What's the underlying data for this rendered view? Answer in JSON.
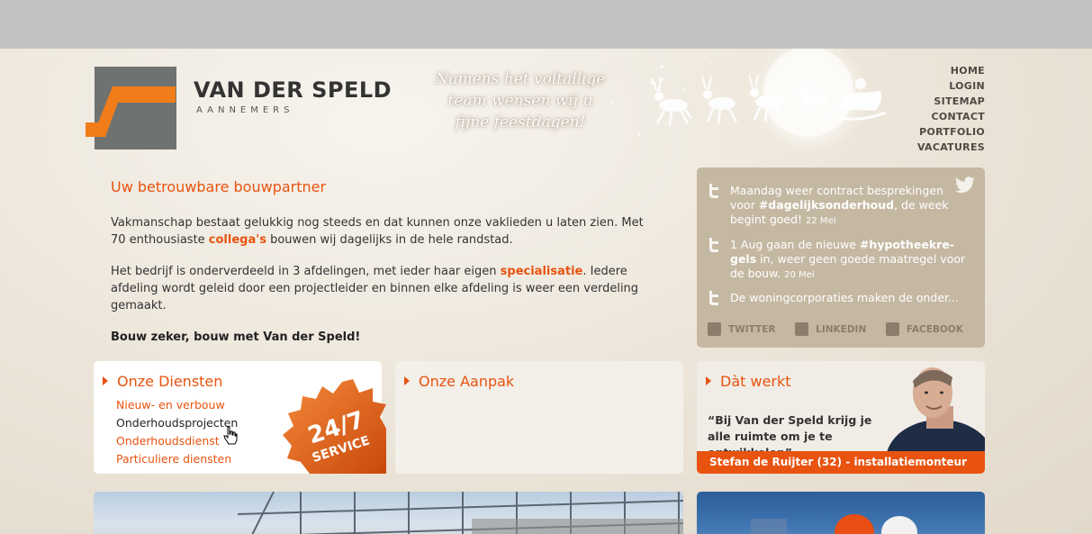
{
  "logo": {
    "main": "VAN DER SPELD",
    "sub": "AANNEMERS"
  },
  "banner": {
    "lines": [
      "Namens het voltallige",
      "team wensen wij u",
      "fijne feestdagen!"
    ]
  },
  "nav": {
    "items": [
      "HOME",
      "LOGIN",
      "SITEMAP",
      "CONTACT",
      "PORTFOLIO",
      "VACATURES"
    ]
  },
  "intro": {
    "title": "Uw betrouwbare bouwpartner",
    "p1_a": "Vakmanschap bestaat gelukkig nog steeds en dat kunnen onze vaklieden u laten zien. Met 70 enthousiaste ",
    "p1_link": "collega's",
    "p1_b": " bouwen wij dagelijks in de hele randstad.",
    "p2_a": "Het bedrijf is onderverdeeld in 3 afdelingen, met ieder haar eigen ",
    "p2_link": "specialisatie",
    "p2_b": ". Iedere afdeling wordt geleid door een projectleider en binnen elke afdeling is weer een verdeling gemaakt.",
    "p3": "Bouw zeker, bouw met Van der Speld!"
  },
  "tweets": [
    {
      "a": "Maandag weer contract besprekingen voor ",
      "tag": "#dagelijksonderhoud",
      "b": ", de week begint goed! ",
      "date": "22 Mei"
    },
    {
      "a": "1 Aug gaan de nieuwe ",
      "tag": "#hypotheekre-gels",
      "b": " in, weer geen goede maatregel voor de bouw. ",
      "date": "20 Mei"
    },
    {
      "a": "De woningcorporaties maken de onder...",
      "tag": "",
      "b": "",
      "date": ""
    }
  ],
  "social": {
    "twitter": "TWITTER",
    "linkedin": "LINKEDIN",
    "facebook": "FACEBOOK"
  },
  "panels": {
    "diensten": {
      "title": "Onze Diensten",
      "items": [
        "Nieuw- en verbouw",
        "Onderhoudsprojecten",
        "Onderhoudsdienst",
        "Particuliere diensten"
      ],
      "active_index": 1,
      "seal_line1": "24/7",
      "seal_line2": "SERVICE"
    },
    "aanpak": {
      "title": "Onze Aanpak"
    },
    "werkt": {
      "title": "Dàt werkt",
      "quote": "“Bij Van der Speld krijg je alle ruimte om je te ontwikkelen”",
      "caption": "Stefan de Ruijter (32) - installatiemonteur"
    }
  },
  "colors": {
    "accent": "#e8530f",
    "tweetbox": "#c5b8a2",
    "topbar": "#c2c2c2",
    "logo_gray": "#6e7271"
  }
}
